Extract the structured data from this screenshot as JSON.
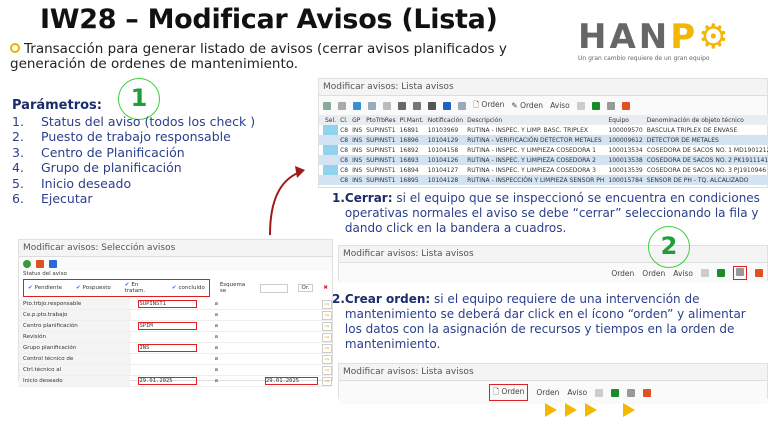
{
  "title": "IW28 – Modificar Avisos (Lista)",
  "subtitle": "Transacción para generar listado de avisos (cerrar avisos planificados y generación de ordenes de mantenimiento.",
  "logo": {
    "name": "HANPO",
    "tagline": "Un gran cambio requiere de un gran equipo"
  },
  "markers": {
    "one": "1",
    "two": "2"
  },
  "params": {
    "heading": "Parámetros:",
    "items": [
      {
        "n": "1.",
        "t": "Status del aviso (todos los check )"
      },
      {
        "n": "2.",
        "t": "Puesto de trabajo responsable"
      },
      {
        "n": "3.",
        "t": "Centro de Planificación"
      },
      {
        "n": "4.",
        "t": "Grupo de planificación"
      },
      {
        "n": "5.",
        "t": "Inicio deseado"
      },
      {
        "n": "6.",
        "t": "Ejecutar"
      }
    ]
  },
  "list": {
    "title": "Modificar avisos: Lista avisos",
    "toolbar": {
      "orden1": "Orden",
      "orden2": "Orden",
      "aviso": "Aviso"
    },
    "columns": [
      "Sel.",
      "Cl.",
      "GP",
      "PtoTrbRes",
      "Pl.Mant.",
      "Notificación",
      "Descripción",
      "Equipo",
      "Denominación de objeto técnico"
    ],
    "rows": [
      [
        "",
        "C8",
        "INS",
        "SUPINST1",
        "16891",
        "10103969",
        "RUTINA - INSPEC. Y LIMP. BASC. TRIPLEX",
        "100009570",
        "BASCULA TRIPLEX DE ENVASE"
      ],
      [
        "",
        "C8",
        "INS",
        "SUPINST1",
        "16896",
        "10104129",
        "RUTINA - VERIFICACIÓN DETECTOR METALES",
        "100009612",
        "DETECTOR DE METALES"
      ],
      [
        "",
        "C8",
        "INS",
        "SUPINST1",
        "16892",
        "10104158",
        "RUTINA - INSPEC. Y LIMPIEZA COSEDORA 1",
        "100013534",
        "COSEDORA DE SACOS NO. 1   MD1901212"
      ],
      [
        "",
        "C8",
        "INS",
        "SUPINST1",
        "16893",
        "10104126",
        "RUTINA - INSPEC. Y LIMPIEZA COSEDORA 2",
        "100013538",
        "COSEDORA DE SACOS NO. 2   PK1911141"
      ],
      [
        "",
        "C8",
        "INS",
        "SUPINST1",
        "16894",
        "10104127",
        "RUTINA - INSPEC. Y LIMPIEZA COSEDORA 3",
        "100013539",
        "COSEDORA DE SACOS NO. 3   PJ1910946"
      ],
      [
        "",
        "C8",
        "INS",
        "SUPINST1",
        "16895",
        "10104128",
        "RUTINA - INSPECCIÓN Y LIMPIEZA SENSOR PH",
        "100015784",
        "SENSOR DE PH - TQ. ALCALIZADO"
      ]
    ]
  },
  "selection": {
    "title": "Modificar avisos: Selección avisos",
    "status_label": "Status del aviso",
    "status": [
      "Pendiente",
      "Pospuesto",
      "En tratam.",
      "concluido"
    ],
    "esquema": "Esquema se",
    "or": "Or.",
    "fields": [
      {
        "label": "Pto.trbjo.responsable",
        "from": "SUPINST1",
        "to": ""
      },
      {
        "label": "Ce.p.pto.trabajo",
        "from": "",
        "to": ""
      },
      {
        "label": "Centro planificación",
        "from": "SPIM",
        "to": ""
      },
      {
        "label": "Revisión",
        "from": "",
        "to": ""
      },
      {
        "label": "Grupo planificación",
        "from": "INS",
        "to": ""
      },
      {
        "label": "Control técnico de",
        "from": "",
        "to": ""
      },
      {
        "label": "Ctrl.técnico al",
        "from": "",
        "to": ""
      },
      {
        "label": "Inicio deseado",
        "from": "29.01.2025",
        "to": "29.01.2025"
      }
    ],
    "a": "a"
  },
  "steps": [
    {
      "n": "1.",
      "bold": "Cerrar:",
      "text": " si el equipo que se inspeccionó se encuentra en condiciones operativas normales el aviso se debe “cerrar” seleccionando la fila y dando click en la bandera a cuadros."
    },
    {
      "n": "2.",
      "bold": "Crear orden:",
      "text": " si el equipo requiere de una intervención de mantenimiento se deberá dar click en el ícono “orden” y alimentar los datos con la asignación de recursos y tiempos en la orden de mantenimiento."
    }
  ],
  "colors": {
    "accent": "#f2b705",
    "navy": "#1a2c6b",
    "highlight": "#e02020",
    "marker": "#3dd13d"
  }
}
